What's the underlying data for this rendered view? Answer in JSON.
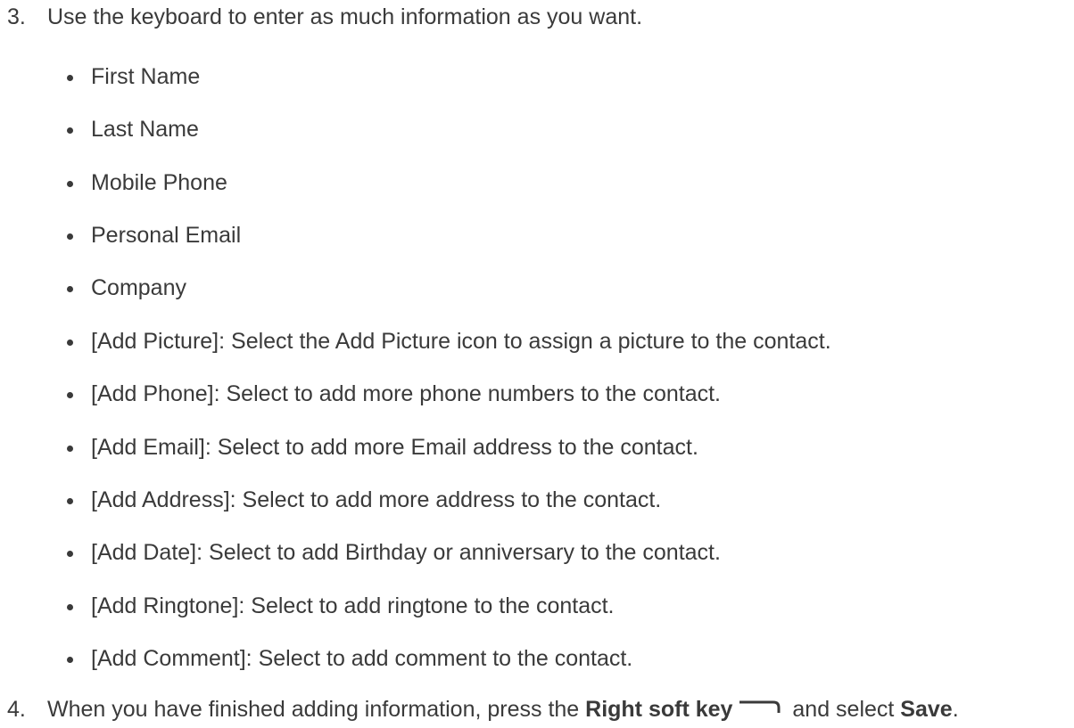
{
  "steps": [
    {
      "number": "3.",
      "text": "Use the keyboard to enter as much information as you want."
    },
    {
      "number": "4.",
      "text_before": "When you have finished adding information, press the ",
      "bold_key": "Right soft key",
      "text_middle": " and select ",
      "bold_action": "Save",
      "text_end": "."
    }
  ],
  "bullets": [
    "First Name",
    "Last Name",
    "Mobile Phone",
    "Personal Email",
    "Company",
    "[Add Picture]: Select the Add Picture icon to assign a picture to the contact.",
    "[Add Phone]: Select to add more phone numbers to the contact.",
    "[Add Email]: Select to add more Email address to the contact.",
    "[Add Address]: Select to add more address to the contact.",
    "[Add Date]: Select to add Birthday or anniversary to the contact.",
    "[Add Ringtone]: Select to add ringtone to the contact.",
    "[Add Comment]: Select to add comment to the contact."
  ],
  "icons": {
    "softkey": "right-soft-key-icon"
  },
  "colors": {
    "text": "#3a3a3a"
  }
}
